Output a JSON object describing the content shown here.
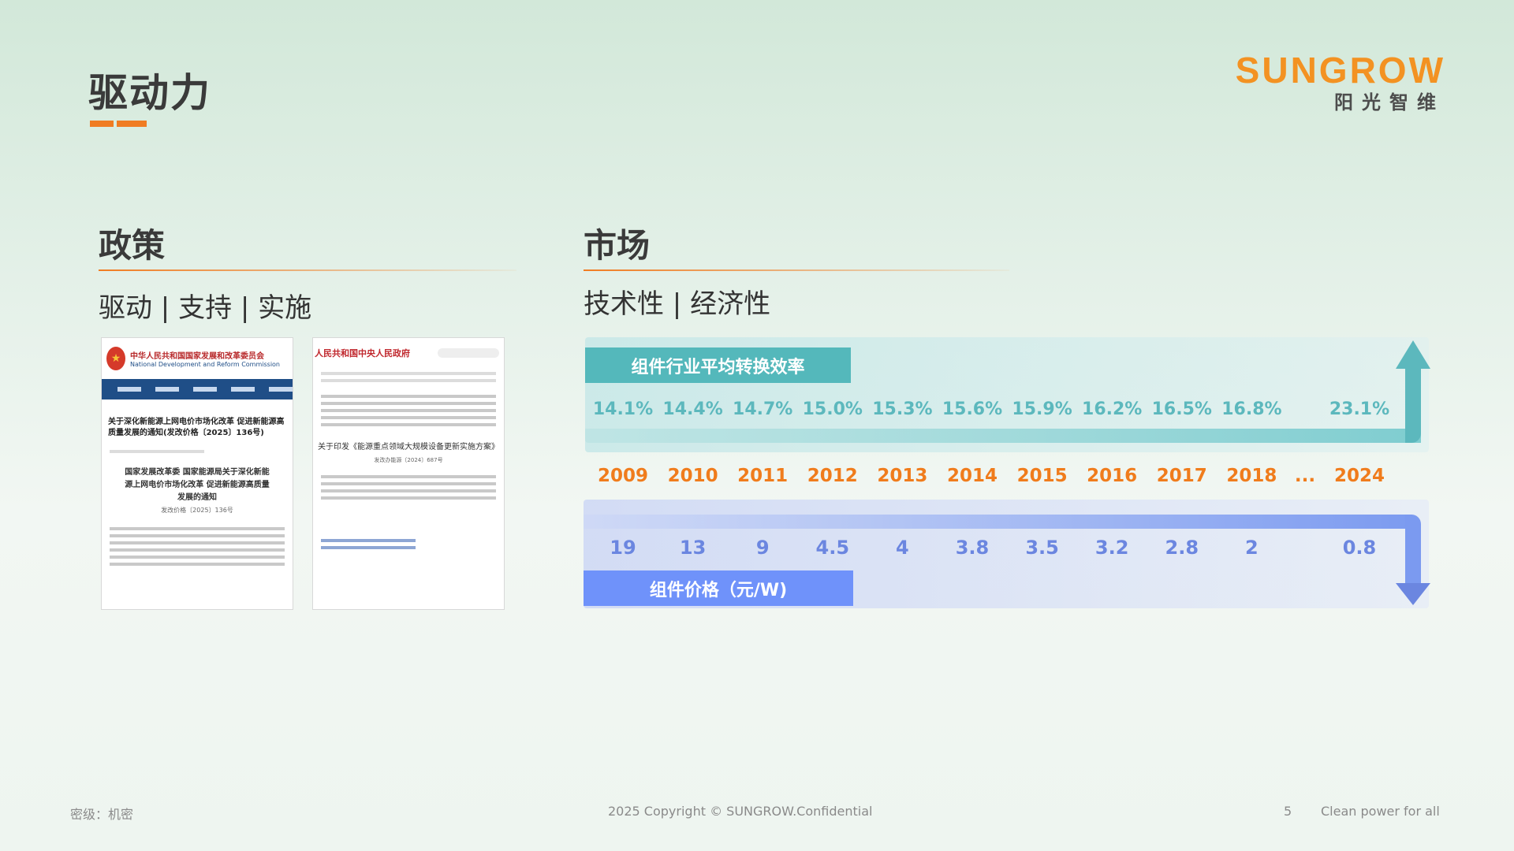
{
  "page": {
    "title": "驱动力",
    "logo_word": "SUNGROW",
    "logo_sub": "阳光智维"
  },
  "policy": {
    "heading": "政策",
    "subtitle": "驱动 | 支持 | 实施",
    "doc1": {
      "agency": "中华人民共和国国家发展和改革委员会",
      "agency_en": "National Development and Reform Commission",
      "title": "关于深化新能源上网电价市场化改革 促进新能源高质量发展的通知(发改价格〔2025〕136号)",
      "body_title": "国家发展改革委 国家能源局关于深化新能源上网电价市场化改革 促进新能源高质量发展的通知",
      "doc_no": "发改价格〔2025〕136号"
    },
    "doc2": {
      "agency": "人民共和国中央人民政府",
      "title": "关于印发《能源重点领域大规模设备更新实施方案》",
      "doc_no": "发改办能源〔2024〕687号"
    }
  },
  "market": {
    "heading": "市场",
    "subtitle": "技术性 | 经济性",
    "efficiency_label": "组件行业平均转换效率",
    "price_label": "组件价格（元/W)",
    "colors": {
      "efficiency": "#5cb8bd",
      "year": "#f07c1c",
      "price": "#6b86e0"
    },
    "years": [
      "2009",
      "2010",
      "2011",
      "2012",
      "2013",
      "2014",
      "2015",
      "2016",
      "2017",
      "2018",
      "...",
      "2024"
    ],
    "efficiency": [
      "14.1%",
      "14.4%",
      "14.7%",
      "15.0%",
      "15.3%",
      "15.6%",
      "15.9%",
      "16.2%",
      "16.5%",
      "16.8%",
      "",
      "23.1%"
    ],
    "price": [
      "19",
      "13",
      "9",
      "4.5",
      "4",
      "3.8",
      "3.5",
      "3.2",
      "2.8",
      "2",
      "",
      "0.8"
    ]
  },
  "footer": {
    "security": "密级：机密",
    "copyright": "2025 Copyright © SUNGROW.Confidential",
    "page_no": "5",
    "slogan": "Clean power for all"
  }
}
